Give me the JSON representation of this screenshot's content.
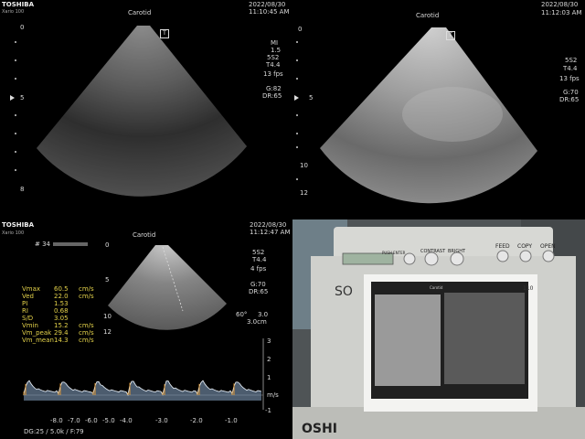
{
  "panels": {
    "top_left": {
      "brand": "TOSHIBA",
      "model": "Xario 100",
      "title": "Carotid",
      "date": "2022/08/30",
      "time": "11:10:45 AM",
      "params": [
        "MI",
        "1.5",
        "5S2",
        "T4.4",
        "13 fps",
        "G:82",
        "DR:65"
      ],
      "depth_labels": [
        "0",
        "5",
        "8"
      ],
      "focus_marker": "T"
    },
    "top_right": {
      "date": "2022/08/30",
      "time": "11:12:03 AM",
      "title": "Carotid",
      "params": [
        "5S2",
        "T4.4",
        "13 fps",
        "G:70",
        "DR:65"
      ],
      "depth_labels": [
        "0",
        "5",
        "10",
        "12"
      ],
      "focus_marker": "T"
    },
    "bottom_left": {
      "brand": "TOSHIBA",
      "model": "Xario 100",
      "title": "Carotid",
      "date": "2022/08/30",
      "time": "11:12:47 AM",
      "frame": "# 34",
      "params": [
        "5S2",
        "T4.4",
        "4 fps",
        "G:70",
        "DR:65"
      ],
      "angle": "60°",
      "gate": "3.0",
      "gate_depth": "3.0cm",
      "depth_labels": [
        "0",
        "5",
        "10",
        "12"
      ],
      "measurements": [
        {
          "label": "Vmax",
          "value": "60.5",
          "unit": "cm/s"
        },
        {
          "label": "Ved",
          "value": "22.0",
          "unit": "cm/s"
        },
        {
          "label": "PI",
          "value": "1.53",
          "unit": ""
        },
        {
          "label": "RI",
          "value": "0.68",
          "unit": ""
        },
        {
          "label": "S/D",
          "value": "3.05",
          "unit": ""
        },
        {
          "label": "Vmin",
          "value": "15.2",
          "unit": "cm/s"
        },
        {
          "label": "Vm_peak",
          "value": "29.4",
          "unit": "cm/s"
        },
        {
          "label": "Vm_mean",
          "value": "14.3",
          "unit": "cm/s"
        }
      ],
      "spectrum_scale": [
        "3",
        "2",
        "1",
        "m/s",
        "-1"
      ],
      "time_axis": [
        "-8.0",
        "-7.0",
        "-6.0",
        "-5.0",
        "-4.0",
        "-3.0",
        "-2.0",
        "-1.0"
      ],
      "footer": "DG:25 / 5.0k / F:79"
    },
    "bottom_right": {
      "button_labels": [
        "PUSH ENTER",
        "CONTRAST",
        "BRIGHT",
        "FEED",
        "COPY",
        "OPEN"
      ],
      "body_text": "SO",
      "bottom_brand_fragment": "OSHI",
      "print_title": "Carotid",
      "side_label": "110"
    }
  }
}
